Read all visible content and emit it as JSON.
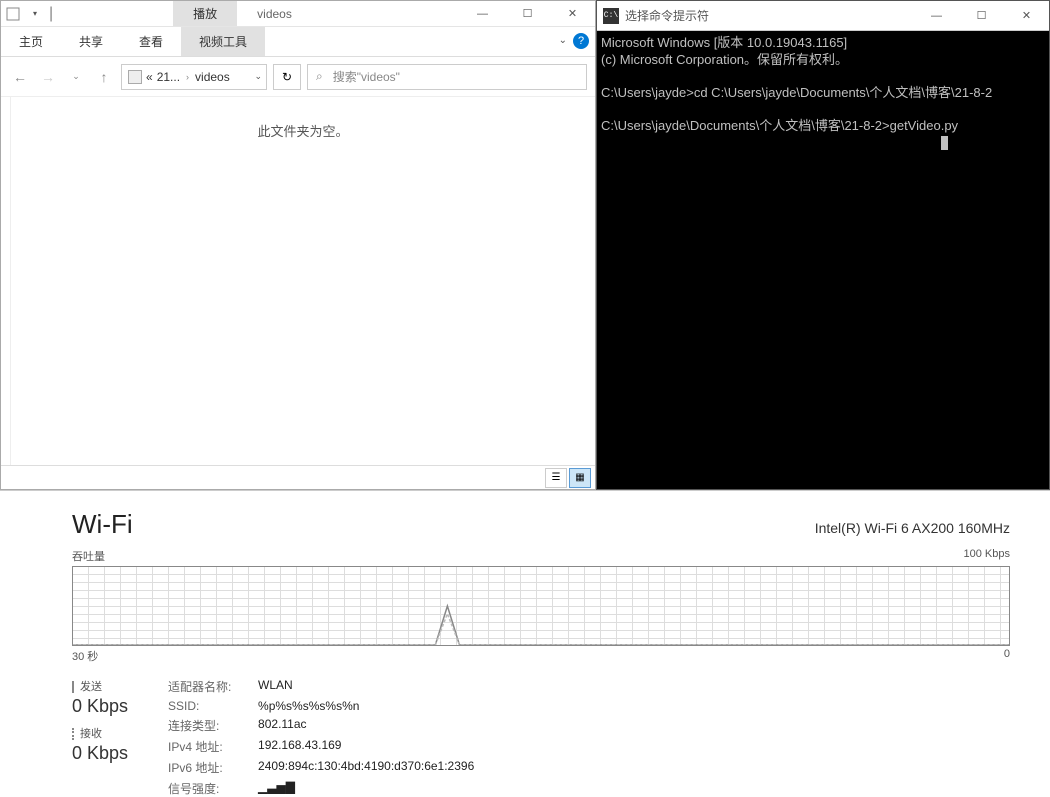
{
  "explorer": {
    "play_tab": "播放",
    "title": "videos",
    "ribbon": {
      "home": "主页",
      "share": "共享",
      "view": "查看",
      "video": "视频工具"
    },
    "helptip": "?",
    "breadcrumb": {
      "prefix": "«",
      "part1": "21...",
      "part2": "videos"
    },
    "search_placeholder": "搜索\"videos\"",
    "empty_msg": "此文件夹为空。"
  },
  "cmd": {
    "title": "选择命令提示符",
    "line1": "Microsoft Windows [版本 10.0.19043.1165]",
    "line2": "(c) Microsoft Corporation。保留所有权利。",
    "line3a": "C:\\Users\\jayde>cd C:\\Users\\jayde\\Documents\\个人文档\\博客\\21-8-2",
    "line4a": "C:\\Users\\jayde\\Documents\\个人文档\\博客\\21-8-2>getVideo.py"
  },
  "wifi": {
    "name": "Wi-Fi",
    "adapter": "Intel(R) Wi-Fi 6 AX200 160MHz",
    "throughput_label": "吞吐量",
    "yaxis_top": "100 Kbps",
    "xaxis_left": "30 秒",
    "xaxis_right": "0",
    "send_label": "发送",
    "send_val": "0 Kbps",
    "recv_label": "接收",
    "recv_val": "0 Kbps",
    "kv": {
      "adapter_name_k": "适配器名称:",
      "adapter_name_v": "WLAN",
      "ssid_k": "SSID:",
      "ssid_v": "%p%s%s%s%s%n",
      "conn_k": "连接类型:",
      "conn_v": "802.11ac",
      "ipv4_k": "IPv4 地址:",
      "ipv4_v": "192.168.43.169",
      "ipv6_k": "IPv6 地址:",
      "ipv6_v": "2409:894c:130:4bd:4190:d370:6e1:2396",
      "signal_k": "信号强度:"
    }
  },
  "chart_data": {
    "type": "line",
    "title": "Wi-Fi 吞吐量",
    "xlabel": "秒",
    "ylabel": "Kbps",
    "xlim": [
      0,
      30
    ],
    "ylim": [
      0,
      100
    ],
    "series": [
      {
        "name": "发送",
        "values": [
          0,
          0,
          0,
          0,
          0,
          0,
          0,
          0,
          0,
          0,
          0,
          0,
          0,
          0,
          50,
          0,
          0,
          0,
          0,
          0,
          0,
          0,
          0,
          0,
          0,
          0,
          0,
          0,
          0,
          0,
          0
        ]
      },
      {
        "name": "接收",
        "values": [
          0,
          0,
          0,
          0,
          0,
          0,
          0,
          0,
          0,
          0,
          0,
          0,
          0,
          0,
          40,
          0,
          0,
          0,
          0,
          0,
          0,
          0,
          0,
          0,
          0,
          0,
          0,
          0,
          0,
          0,
          0
        ]
      }
    ]
  }
}
